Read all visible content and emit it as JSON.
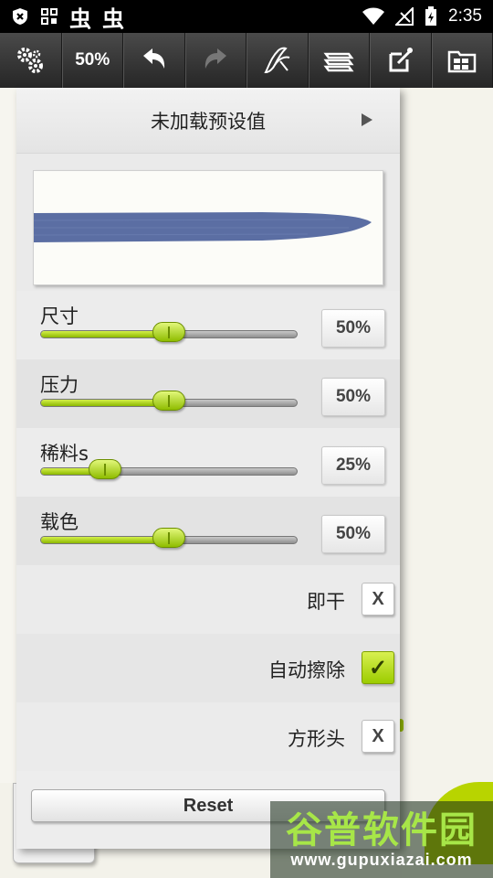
{
  "status_bar": {
    "time": "2:35",
    "notif_glyph_1": "虫",
    "notif_glyph_2": "虫"
  },
  "toolbar": {
    "zoom": "50%"
  },
  "panel": {
    "preset_label": "未加载预设值",
    "sliders": [
      {
        "label": "尺寸",
        "value_text": "50%",
        "value": 50
      },
      {
        "label": "压力",
        "value_text": "50%",
        "value": 50
      },
      {
        "label": "稀料s",
        "value_text": "25%",
        "value": 25
      },
      {
        "label": "载色",
        "value_text": "50%",
        "value": 50
      }
    ],
    "toggles": [
      {
        "label": "即干",
        "state_text": "X",
        "checked": false
      },
      {
        "label": "自动擦除",
        "state_text": "✓",
        "checked": true
      },
      {
        "label": "方形头",
        "state_text": "X",
        "checked": false
      }
    ],
    "reset_label": "Reset",
    "stroke_color": "#5b6ea3"
  },
  "watermark": {
    "title": "谷普软件园",
    "url": "www.gupuxiazai.com"
  },
  "colors": {
    "accent": "#a4d000",
    "toolbar": "#333333"
  }
}
